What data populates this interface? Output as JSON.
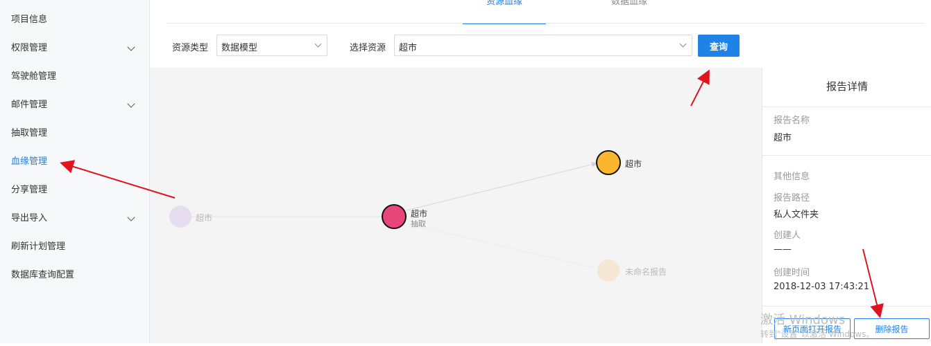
{
  "sidebar": {
    "items": [
      {
        "label": "项目信息",
        "has_children": false
      },
      {
        "label": "权限管理",
        "has_children": true
      },
      {
        "label": "驾驶舱管理",
        "has_children": false
      },
      {
        "label": "邮件管理",
        "has_children": true
      },
      {
        "label": "抽取管理",
        "has_children": false
      },
      {
        "label": "血缘管理",
        "has_children": false,
        "active": true
      },
      {
        "label": "分享管理",
        "has_children": false
      },
      {
        "label": "导出导入",
        "has_children": true
      },
      {
        "label": "刷新计划管理",
        "has_children": false
      },
      {
        "label": "数据库查询配置",
        "has_children": false
      }
    ]
  },
  "tabs": [
    {
      "label": "资源血缘",
      "active": true
    },
    {
      "label": "数据血缘",
      "active": false
    }
  ],
  "filter": {
    "type_label": "资源类型",
    "type_value": "数据模型",
    "resource_label": "选择资源",
    "resource_value": "超市",
    "query_label": "查询"
  },
  "graph": {
    "nodes": [
      {
        "label": "超市",
        "sublabel": "",
        "color": "#c9a8e8",
        "faded": true
      },
      {
        "label": "超市",
        "sublabel": "抽取",
        "color": "#e8457a",
        "faded": false
      },
      {
        "label": "超市",
        "sublabel": "",
        "color": "#fbb52e",
        "faded": false
      },
      {
        "label": "未命名报告",
        "sublabel": "",
        "color": "#fbc78a",
        "faded": true
      }
    ]
  },
  "panel": {
    "title": "报告详情",
    "report_name_label": "报告名称",
    "report_name_value": "超市",
    "other_info_label": "其他信息",
    "path_label": "报告路径",
    "path_value": "私人文件夹",
    "creator_label": "创建人",
    "creator_value": "——",
    "created_time_label": "创建时间",
    "created_time_value": "2018-12-03 17:43:21",
    "open_button": "新页面打开报告",
    "delete_button": "删除报告"
  },
  "watermark": {
    "line1": "激活 Windows",
    "line2": "转到\"设置\"以激活 Windows。"
  },
  "colors": {
    "accent": "#1e82e6",
    "annotation_arrow": "#e0141e"
  }
}
